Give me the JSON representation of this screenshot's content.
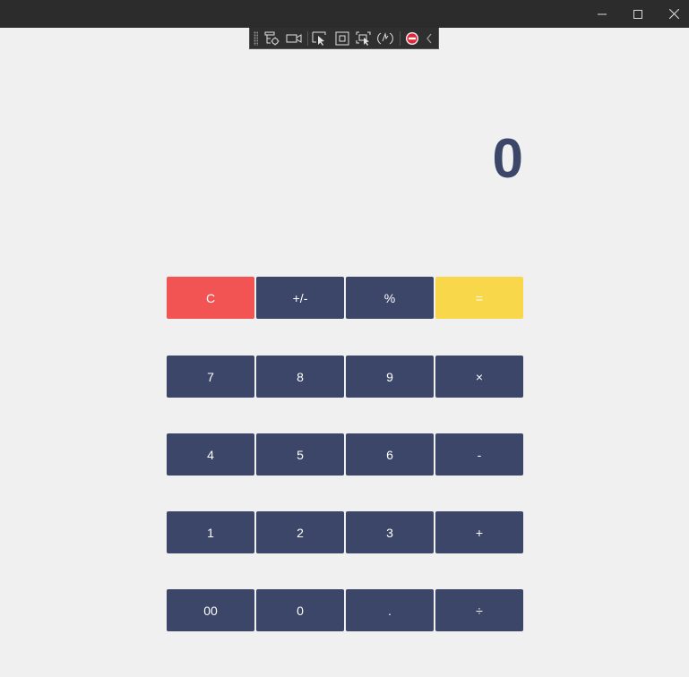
{
  "window": {
    "controls": [
      "minimize-icon",
      "maximize-icon",
      "close-icon"
    ]
  },
  "dev_toolbar": {
    "tools": [
      "live-visual-tree-icon",
      "video-camera-icon",
      "select-element-icon",
      "display-layout-adorners-icon",
      "track-focus-icon",
      "hot-reload-icon",
      "stop-icon",
      "collapse-chevron-icon"
    ]
  },
  "display": {
    "value": "0"
  },
  "keys": {
    "row1": [
      "C",
      "+/-",
      "%",
      "="
    ],
    "row2": [
      "7",
      "8",
      "9",
      "×"
    ],
    "row3": [
      "4",
      "5",
      "6",
      "-"
    ],
    "row4": [
      "1",
      "2",
      "3",
      "+"
    ],
    "row5": [
      "00",
      "0",
      ".",
      "÷"
    ]
  },
  "colors": {
    "key": "#3b4668",
    "clear": "#f25454",
    "equals": "#f8d84a",
    "background": "#f0f0f0",
    "titlebar": "#2c2c2c"
  }
}
